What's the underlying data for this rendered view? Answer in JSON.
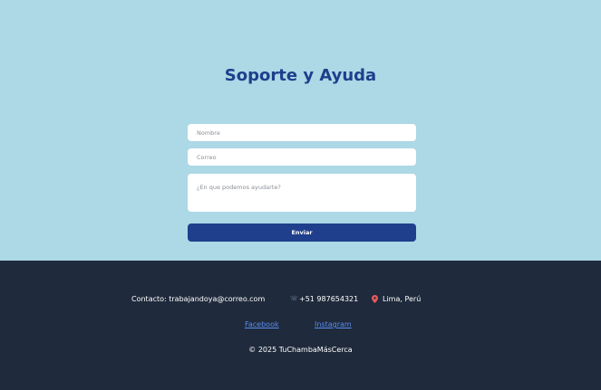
{
  "main": {
    "title": "Soporte y Ayuda",
    "form": {
      "name_placeholder": "Nombre",
      "email_placeholder": "Correo",
      "message_placeholder": "¿En que podemos ayudarte?",
      "submit_label": "Enviar"
    }
  },
  "footer": {
    "contact_email": "Contacto: trabajandoya@correo.com",
    "phone_icon": "phone-icon",
    "phone": "+51 987654321",
    "location_icon": "pin-icon",
    "location": "Lima, Perú",
    "facebook_label": "Facebook",
    "instagram_label": "Instagram",
    "copyright": "© 2025 TuChambaMásCerca"
  },
  "colors": {
    "main_bg": "#add8e6",
    "accent": "#1f3f8c",
    "footer_bg": "#1f2a3c",
    "link": "#5b8ef0"
  }
}
